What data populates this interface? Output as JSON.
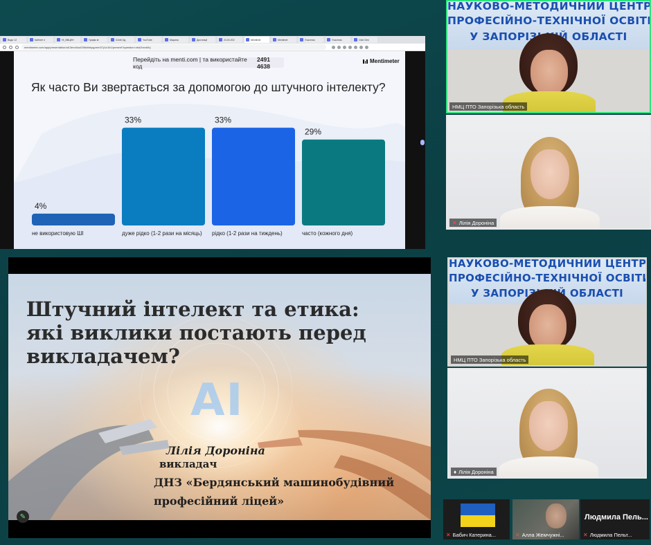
{
  "top_share": {
    "browser": {
      "tabs": [
        "Виде 12",
        "Кабінет н",
        "НІ_ВВЦЕН",
        "Графік вi",
        "ІСАМ Од",
        "YouTube",
        "Марина",
        "Дистанції",
        "24.04.202",
        "Mentimet",
        "Mentimet",
        "Участник",
        "Участник",
        "Odd: Den"
      ],
      "url": "mentimeter.com/app/presentation/al13enx8uu038shlntyqpmm37y1x1b1/present?question=xbd2nxxb0rj"
    },
    "menti": {
      "join_text": "Перейдіть на menti.com | та використайте код",
      "join_code": "2491 4638",
      "logo_text": "Mentimeter",
      "question": "Як часто Ви звертається за допомогою до штучного інтелекту?"
    }
  },
  "chart_data": {
    "type": "bar",
    "title": "Як часто Ви звертається за допомогою до штучного інтелекту?",
    "categories": [
      "не використовую ШІ",
      "дуже рідко (1-2 рази на місяць)",
      "рідко (1-2 рази на тиждень)",
      "часто (кожного дня)"
    ],
    "values": [
      4,
      33,
      33,
      29
    ],
    "value_labels": [
      "4%",
      "33%",
      "33%",
      "29%"
    ],
    "colors": [
      "#1e63b5",
      "#0a7cc0",
      "#1c64e6",
      "#0a7a80"
    ],
    "ylim": [
      0,
      35
    ]
  },
  "participants": {
    "top_host": {
      "name": "НМЦ ПТО Запорізька область"
    },
    "top_guest": {
      "name": "Лілія Дороніна"
    },
    "bottom_host": {
      "name": "НМЦ ПТО Запорізька область"
    },
    "bottom_guest": {
      "name": "Лілія Дороніна"
    },
    "gallery": [
      {
        "name": "Бабич Катерина..."
      },
      {
        "name": "Алла Жемчужні..."
      },
      {
        "name": "Людмила Пельт...",
        "big": "Людмила  Пель..."
      }
    ]
  },
  "banner": {
    "line1": "НАУКОВО-МЕТОДИЧНИЙ ЦЕНТР",
    "line2": "ПРОФЕСІЙНО-ТЕХНІЧНОЇ ОСВІТИ",
    "line3": "У ЗАПОРІЗЬКІЙ ОБЛАСТІ"
  },
  "slide": {
    "title_line1": "Штучний інтелект та етика:",
    "title_line2": "які виклики постають перед",
    "title_line3": "викладачем?",
    "ai_label": "AI",
    "author_name": "Лілія Дороніна",
    "author_role": "викладач",
    "org_line1": "ДНЗ «Бердянський машинобудівний",
    "org_line2": "професійний ліцей»"
  },
  "colors": {
    "speaking_border": "#2ee27c",
    "background": "#0d4a4f"
  }
}
